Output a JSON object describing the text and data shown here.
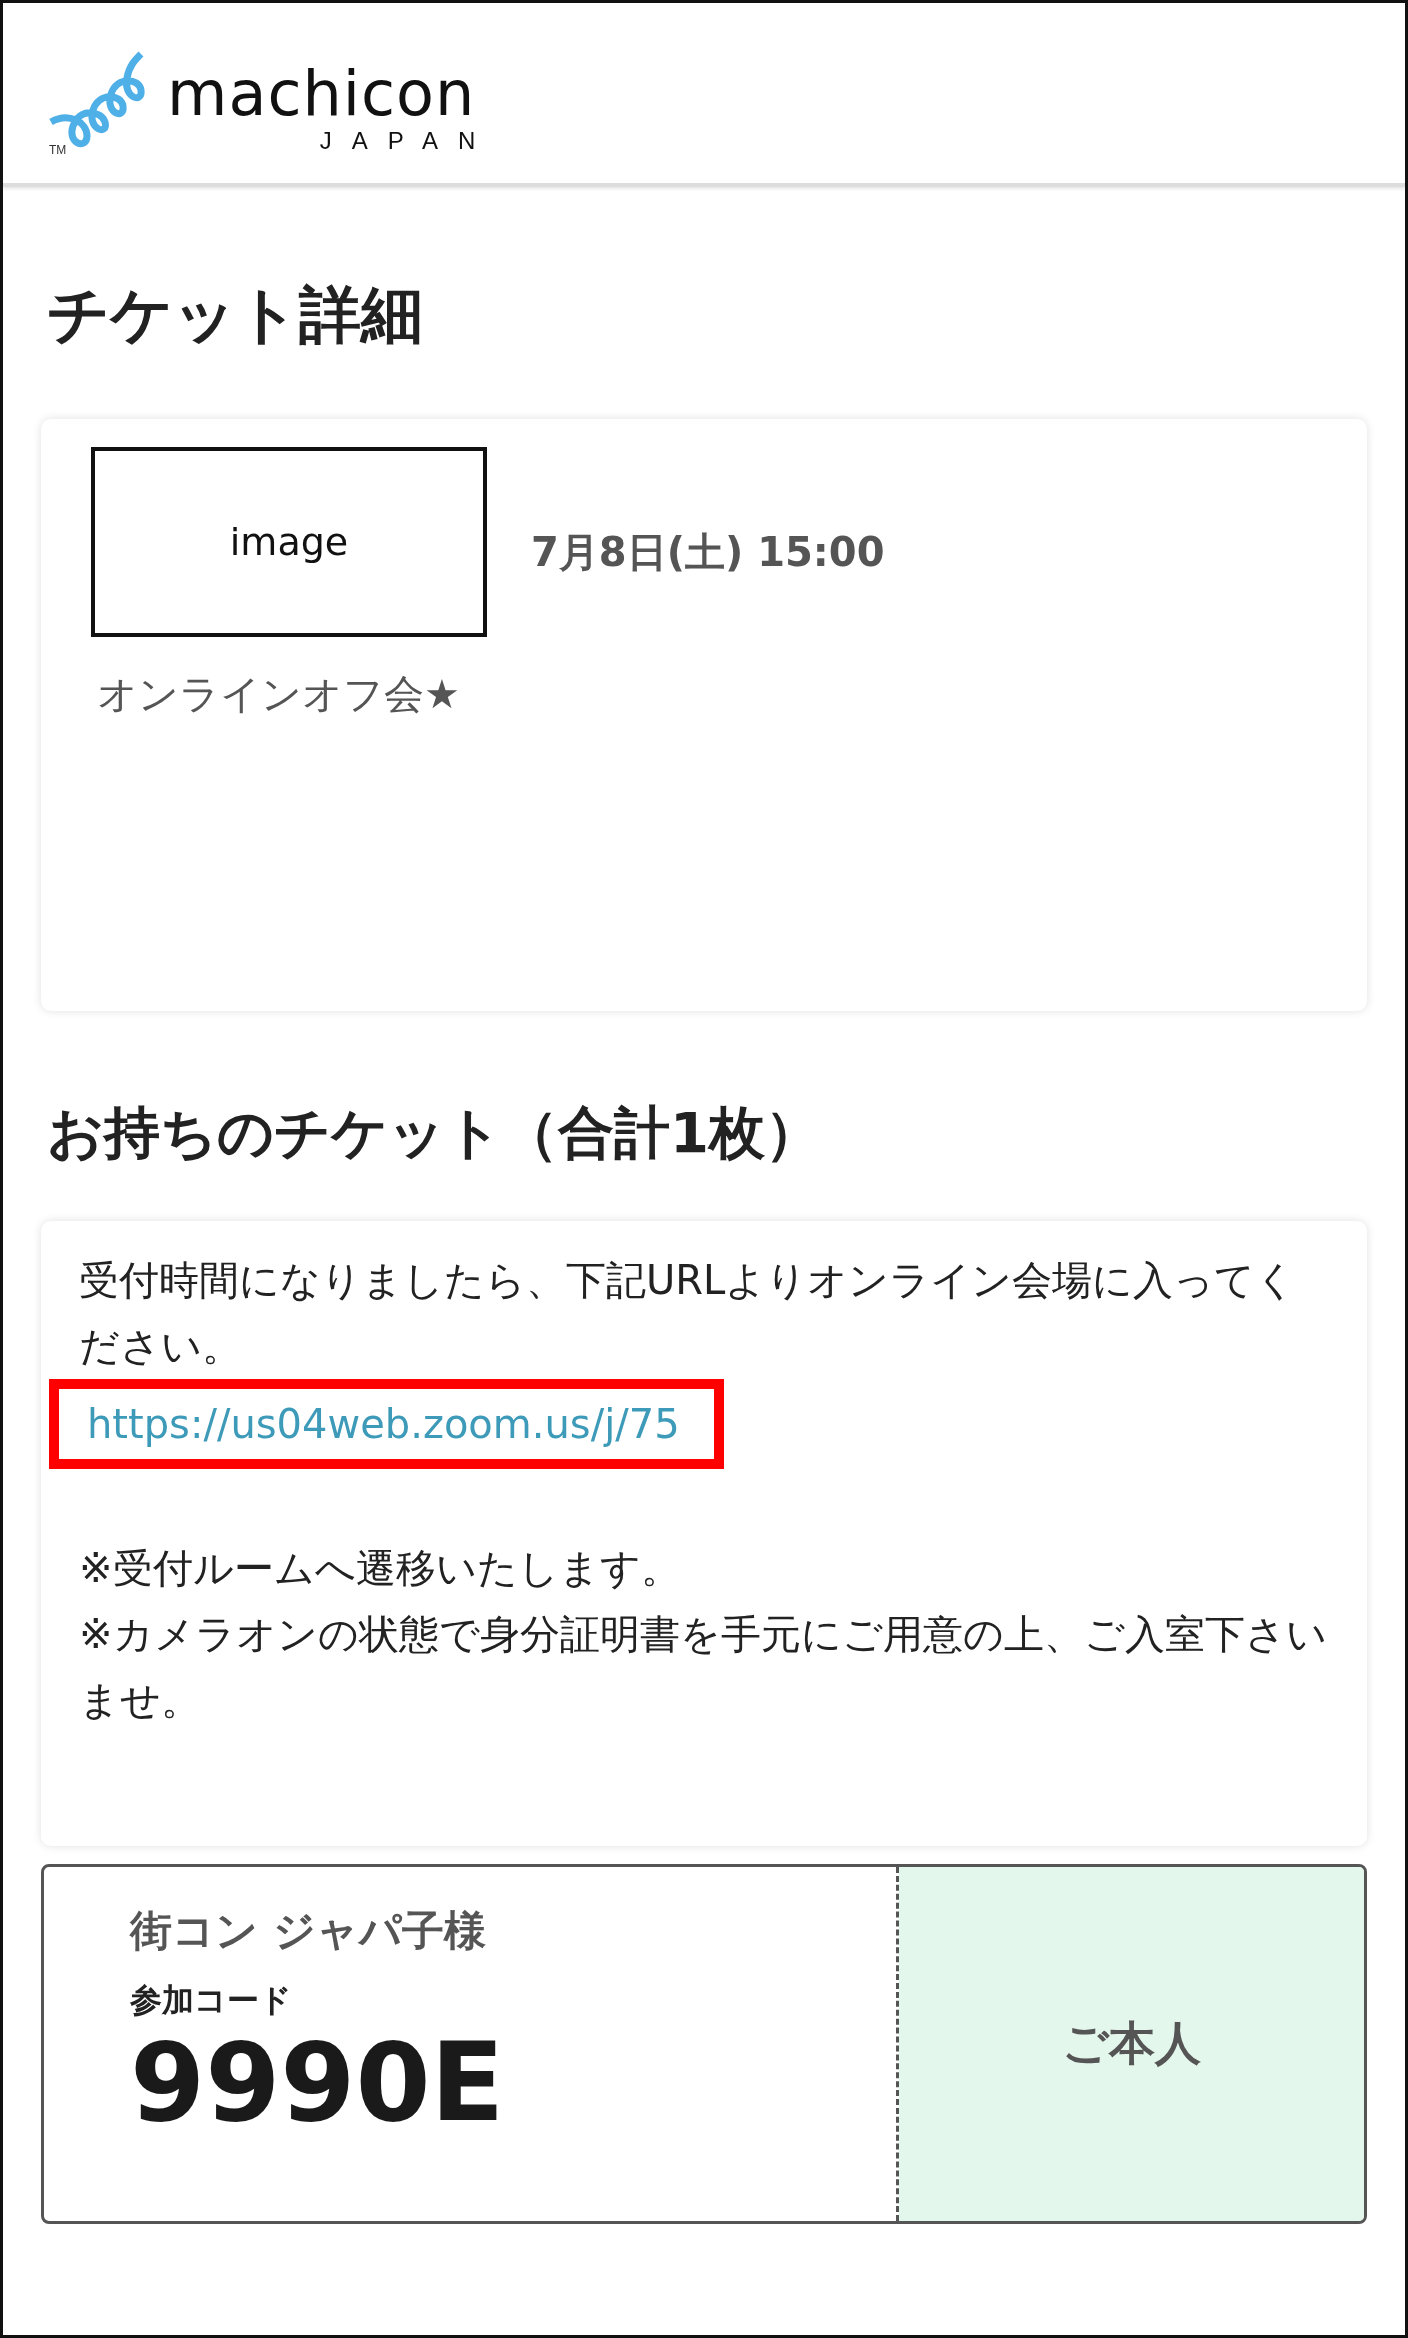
{
  "header": {
    "logo": {
      "wordmark": "machicon",
      "sub": "JAPAN",
      "trademark": "TM"
    }
  },
  "page_title": "チケット詳細",
  "event": {
    "image_label": "image",
    "date": "7月8日(土) 15:00",
    "title": "オンラインオフ会★"
  },
  "tickets_heading": "お持ちのチケット（合計1枚）",
  "notice": {
    "intro": "受付時間になりましたら、下記URLよりオンライン会場に入ってください。",
    "link": {
      "text": "https://us04web.zoom.us/j/75",
      "highlighted": true
    },
    "notes": [
      "※受付ルームへ遷移いたします。",
      "※カメラオンの状態で身分証明書を手元にご用意の上、ご入室下さいませ。"
    ]
  },
  "ticket": {
    "holder": "街コン ジャパ子様",
    "code_label": "参加コード",
    "code": "9990E",
    "status": "ご本人"
  }
}
